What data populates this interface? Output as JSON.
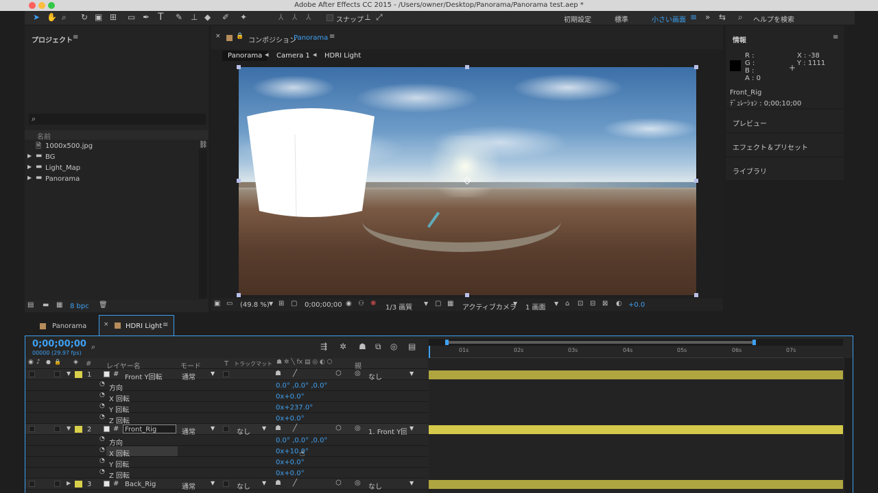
{
  "window": {
    "title": "Adobe After Effects CC 2015 - /Users/owner/Desktop/Panorama/Panorama test.aep *"
  },
  "toolbar": {
    "snap_label": "スナップ",
    "workspaces": [
      "初期設定",
      "標準",
      "小さい画面"
    ],
    "help_search": "ヘルプを検索"
  },
  "project": {
    "title": "プロジェクト",
    "search_placeholder": "",
    "col_name": "名前",
    "items": [
      "1000x500.jpg",
      "BG",
      "Light_Map",
      "Panorama"
    ],
    "bpc": "8 bpc"
  },
  "comp": {
    "tab_prefix": "コンポジション",
    "tab_name": "Panorama",
    "breadcrumbs": [
      "Panorama",
      "Camera 1",
      "HDRI Light"
    ],
    "footer": {
      "zoom": "(49.8 %)",
      "timecode": "0;00;00;00",
      "resolution": "1/3 画質",
      "camera": "アクティブカメラ",
      "views": "1 画面",
      "exposure": "+0.0"
    }
  },
  "info": {
    "title": "情報",
    "r": "R :",
    "g": "G :",
    "b": "B :",
    "a": "A : 0",
    "x": "X : -38",
    "y": "Y : 1111",
    "layer": "Front_Rig",
    "duration": "ﾃﾞｭﾚｰｼｮﾝ : 0;00;10;00"
  },
  "side_panels": [
    "プレビュー",
    "エフェクト＆プリセット",
    "ライブラリ"
  ],
  "timeline": {
    "tabs": [
      "Panorama",
      "HDRI Light"
    ],
    "timecode": "0;00;00;00",
    "fps": "00000 (29.97 fps)",
    "headers": {
      "layer_name": "レイヤー名",
      "mode": "モード",
      "t": "T",
      "trkmat": "トラックマット",
      "parent": "親",
      "num": "#"
    },
    "ticks": [
      "01s",
      "02s",
      "03s",
      "04s",
      "05s",
      "06s",
      "07s"
    ],
    "layers": [
      {
        "num": "1",
        "name": "Front Y回転",
        "mode": "通常",
        "trkmat": "",
        "parent": "なし"
      },
      {
        "num": "2",
        "name": "Front_Rig",
        "mode": "通常",
        "trkmat": "なし",
        "parent": "1. Front Y回転"
      },
      {
        "num": "3",
        "name": "Back_Rig",
        "mode": "通常",
        "trkmat": "なし",
        "parent": "なし"
      }
    ],
    "props1": [
      {
        "name": "方向",
        "value": "0.0° ,0.0° ,0.0°"
      },
      {
        "name": "X 回転",
        "value": "0x+0.0°"
      },
      {
        "name": "Y 回転",
        "value": "0x+237.0°"
      },
      {
        "name": "Z 回転",
        "value": "0x+0.0°"
      }
    ],
    "props2": [
      {
        "name": "方向",
        "value": "0.0° ,0.0° ,0.0°"
      },
      {
        "name": "X 回転",
        "value": "0x+10.0°"
      },
      {
        "name": "Y 回転",
        "value": "0x+0.0°"
      },
      {
        "name": "Z 回転",
        "value": "0x+0.0°"
      }
    ]
  },
  "colors": {
    "accent": "#3ea0f2",
    "label_yellow": "#d8d04a",
    "bar": "#b0a640"
  }
}
